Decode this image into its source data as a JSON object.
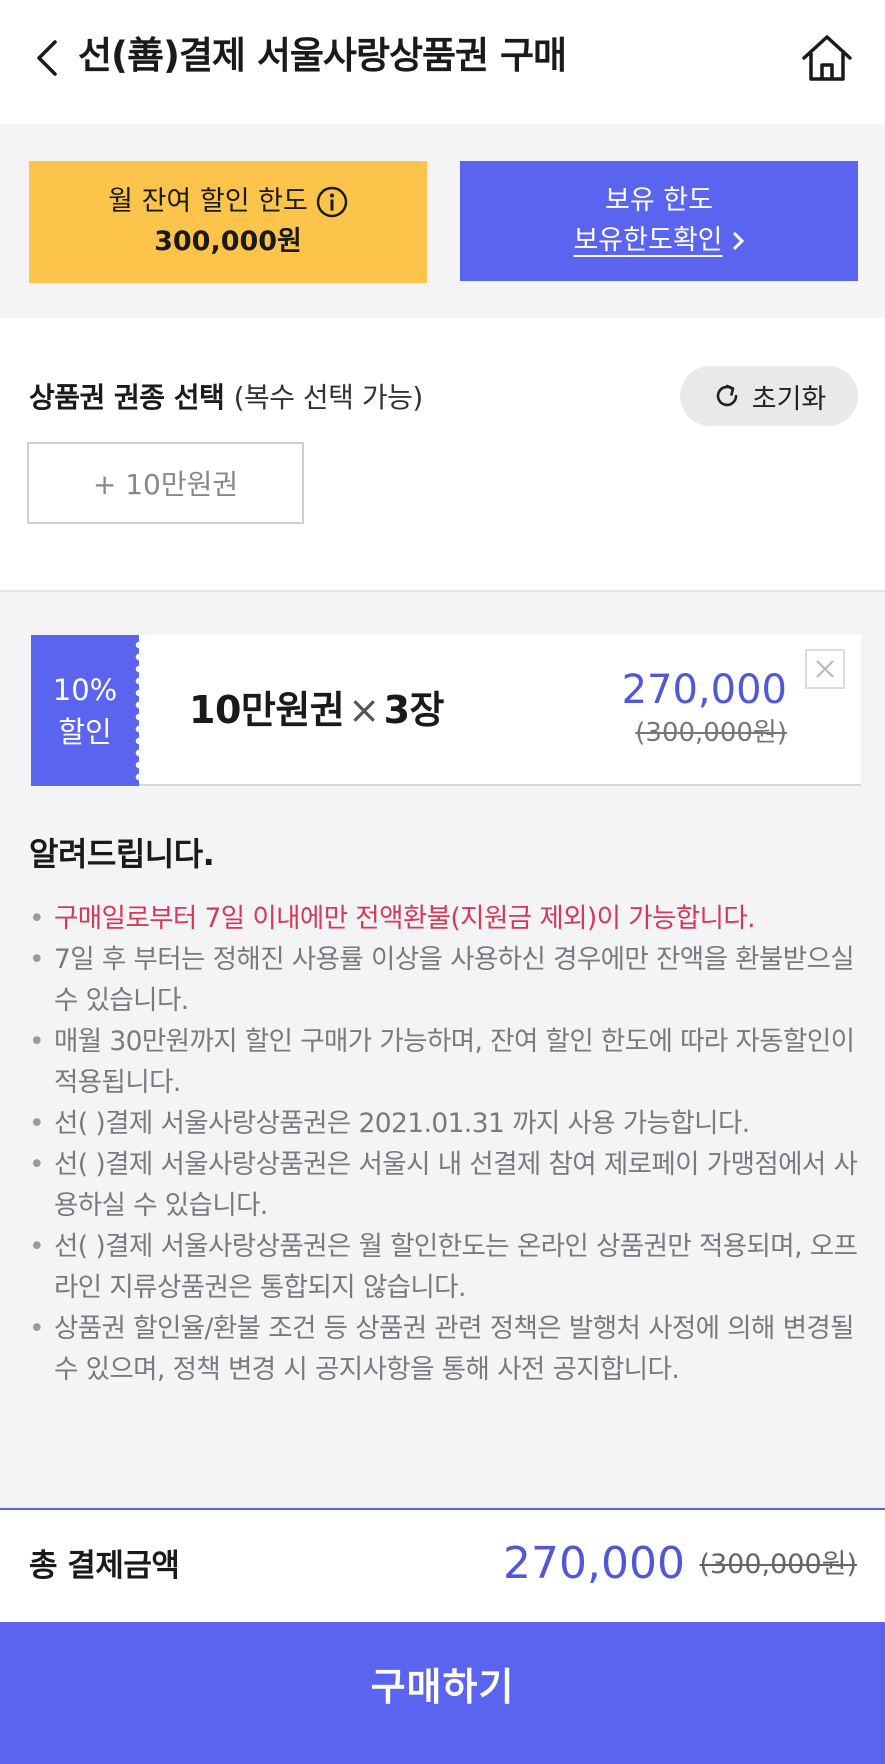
{
  "header": {
    "title": "선(善)결제 서울사랑상품권 구매"
  },
  "limits": {
    "monthly_label": "월 잔여 할인 한도",
    "monthly_amount": "300,000원",
    "holding_label": "보유 한도",
    "holding_link": "보유한도확인"
  },
  "voucher_select": {
    "title": "상품권 권종 선택",
    "subtitle": "(복수 선택 가능)",
    "reset_label": "초기화",
    "add_option": "+ 10만원권"
  },
  "selected_item": {
    "discount_rate": "10%",
    "discount_label": "할인",
    "name": "10만원권",
    "times": "×",
    "quantity": "3장",
    "price": "270,000",
    "original_price": "(300,000원)"
  },
  "notice": {
    "title": "알려드립니다.",
    "items": [
      "구매일로부터 7일 이내에만 전액환불(지원금 제외)이 가능합니다.",
      "7일 후 부터는 정해진 사용률 이상을 사용하신 경우에만 잔액을 환불받으실 수 있습니다.",
      "매월 30만원까지 할인 구매가 가능하며, 잔여 할인 한도에 따라 자동할인이 적용됩니다.",
      "선(    )결제 서울사랑상품권은 2021.01.31 까지 사용 가능합니다.",
      "선(    )결제 서울사랑상품권은 서울시 내 선결제 참여 제로페이 가맹점에서 사용하실 수 있습니다.",
      "선(    )결제 서울사랑상품권은 월 할인한도는 온라인 상품권만 적용되며, 오프라인 지류상품권은 통합되지 않습니다.",
      "상품권 할인율/환불 조건 등 상품권 관련 정책은 발행처 사정에 의해 변경될 수 있으며, 정책 변경 시 공지사항을 통해 사전 공지합니다."
    ]
  },
  "total": {
    "label": "총 결제금액",
    "amount": "270,000",
    "original": "(300,000원)"
  },
  "purchase_button": "구매하기",
  "colors": {
    "primary": "#5b64ee",
    "yellow": "#fcc44a",
    "alert": "#d33a57"
  }
}
